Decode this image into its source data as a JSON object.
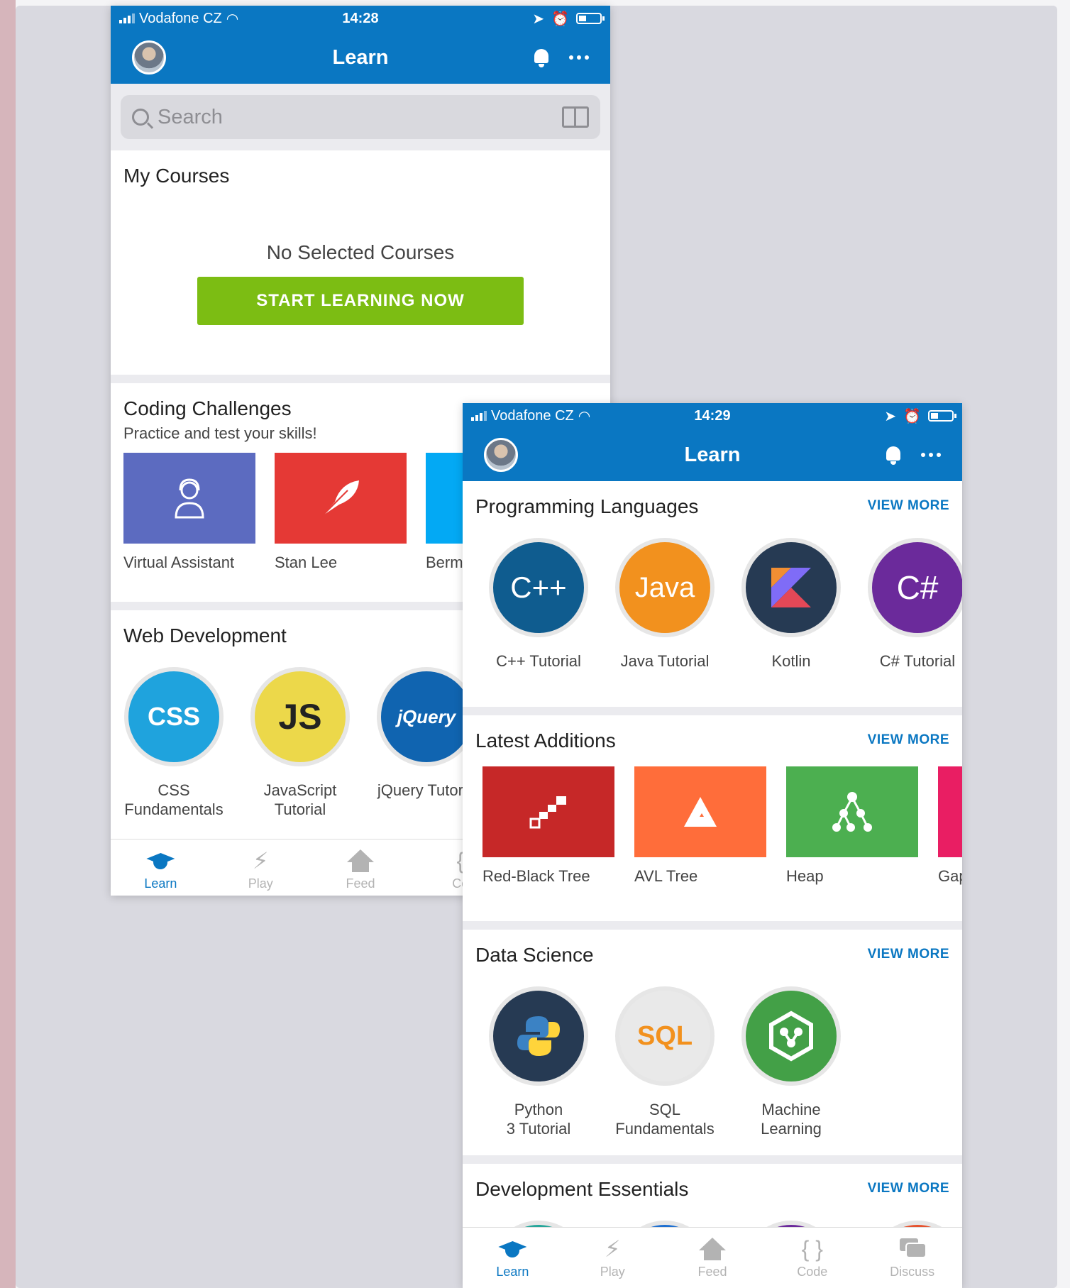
{
  "screenA": {
    "status": {
      "carrier": "Vodafone CZ",
      "time": "14:28"
    },
    "nav": {
      "title": "Learn"
    },
    "search": {
      "placeholder": "Search"
    },
    "my_courses": {
      "title": "My Courses",
      "empty_text": "No Selected Courses",
      "button": "START LEARNING NOW"
    },
    "challenges": {
      "title": "Coding Challenges",
      "subtitle": "Practice and test your skills!",
      "items": [
        {
          "label": "Virtual Assistant",
          "color": "#5c6bc0",
          "icon": "assistant-icon"
        },
        {
          "label": "Stan Lee",
          "color": "#e53935",
          "icon": "feather-icon"
        },
        {
          "label": "Berm",
          "color": "#03a9f4",
          "icon": ""
        }
      ]
    },
    "webdev": {
      "title": "Web Development",
      "items": [
        {
          "label": "CSS\nFundamentals",
          "line1": "CSS",
          "line2": "Fundamentals",
          "badge": "CSS",
          "color": "#1fa3dd"
        },
        {
          "label": "JavaScript Tutorial",
          "line1": "JavaScript",
          "line2": "Tutorial",
          "badge": "JS",
          "color": "#ecd84a"
        },
        {
          "label": "jQuery Tutorial",
          "line1": "jQuery Tutoria",
          "line2": "",
          "badge": "jQuery",
          "color": "#1064b0"
        }
      ]
    },
    "tabs": [
      "Learn",
      "Play",
      "Feed",
      "Co"
    ]
  },
  "screenB": {
    "status": {
      "carrier": "Vodafone CZ",
      "time": "14:29"
    },
    "nav": {
      "title": "Learn"
    },
    "programming": {
      "title": "Programming Languages",
      "view_more": "VIEW MORE",
      "items": [
        {
          "label": "C++ Tutorial",
          "badge": "C++",
          "color": "#0f5c8f"
        },
        {
          "label": "Java Tutorial",
          "badge": "Java",
          "color": "#f2911e"
        },
        {
          "label": "Kotlin",
          "badge": "K",
          "color": "#263a53"
        },
        {
          "label": "C# Tutorial",
          "badge": "C#",
          "color": "#6b2a9b"
        }
      ]
    },
    "latest": {
      "title": "Latest Additions",
      "view_more": "VIEW MORE",
      "items": [
        {
          "label": "Red-Black Tree",
          "color": "#c62828",
          "icon": "stairs-icon"
        },
        {
          "label": "AVL Tree",
          "color": "#ff6d3a",
          "icon": "triangle-icon"
        },
        {
          "label": "Heap",
          "color": "#4caf50",
          "icon": "tree-nodes-icon"
        },
        {
          "label": "Gap",
          "color": "#e91e63",
          "icon": ""
        }
      ]
    },
    "datascience": {
      "title": "Data Science",
      "view_more": "VIEW MORE",
      "items": [
        {
          "line1": "Python",
          "line2": "3 Tutorial",
          "badge": "",
          "color": "#263a53"
        },
        {
          "line1": "SQL",
          "line2": "Fundamentals",
          "badge": "SQL",
          "color": "#e9e9e9"
        },
        {
          "line1": "Machine",
          "line2": "Learning",
          "badge": "",
          "color": "#43a047"
        }
      ]
    },
    "essentials": {
      "title": "Development Essentials",
      "view_more": "VIEW MORE"
    },
    "tabs": [
      "Learn",
      "Play",
      "Feed",
      "Code",
      "Discuss"
    ]
  }
}
